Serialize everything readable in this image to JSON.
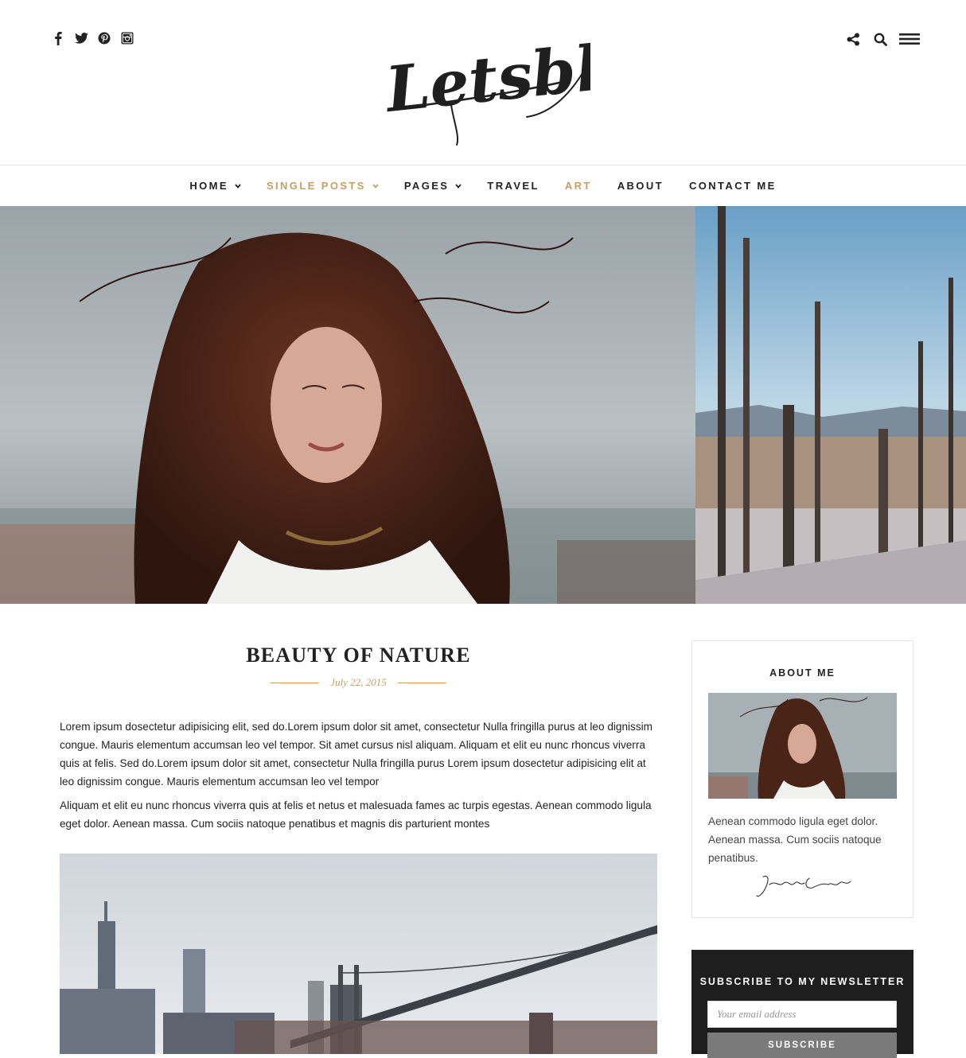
{
  "header": {
    "logo_text": "Letsblog",
    "social_icons": [
      "facebook-icon",
      "twitter-icon",
      "pinterest-icon",
      "instagram-icon"
    ],
    "tool_icons": [
      "share-icon",
      "search-icon",
      "menu-icon"
    ]
  },
  "nav": {
    "items": [
      {
        "label": "HOME",
        "dropdown": true,
        "active": false
      },
      {
        "label": "SINGLE POSTS",
        "dropdown": true,
        "active": true
      },
      {
        "label": "PAGES",
        "dropdown": true,
        "active": false
      },
      {
        "label": "TRAVEL",
        "dropdown": false,
        "active": false
      },
      {
        "label": "ART",
        "dropdown": false,
        "active": true
      },
      {
        "label": "ABOUT",
        "dropdown": false,
        "active": false
      },
      {
        "label": "CONTACT ME",
        "dropdown": false,
        "active": false
      }
    ]
  },
  "post": {
    "title": "BEAUTY OF NATURE",
    "date": "July 22, 2015",
    "paragraphs": [
      "Lorem ipsum dosectetur adipisicing elit, sed do.Lorem ipsum dolor sit amet, consectetur Nulla fringilla purus at leo dignissim congue. Mauris elementum accumsan leo vel tempor. Sit amet cursus nisl aliquam. Aliquam et elit eu nunc rhoncus viverra quis at felis. Sed do.Lorem ipsum dolor sit amet, consectetur Nulla fringilla purus Lorem ipsum dosectetur adipisicing elit at leo dignissim congue. Mauris elementum accumsan leo vel tempor",
      "Aliquam et elit eu nunc rhoncus viverra quis at felis et netus et malesuada fames ac turpis egestas. Aenean commodo ligula eget dolor. Aenean massa. Cum sociis natoque penatibus et magnis dis parturient montes"
    ]
  },
  "sidebar": {
    "about": {
      "title": "ABOUT ME",
      "text": "Aenean commodo ligula eget dolor. Aenean massa. Cum sociis natoque penatibus.",
      "signature": "Jenifer Carter"
    },
    "newsletter": {
      "title": "SUBSCRIBE TO MY NEWSLETTER",
      "placeholder": "Your email address",
      "button_label": "SUBSCRIBE"
    }
  },
  "colors": {
    "accent": "#c5a063",
    "text": "#222222",
    "dark_widget": "#1e1e1e",
    "button": "#7a7a7a"
  }
}
